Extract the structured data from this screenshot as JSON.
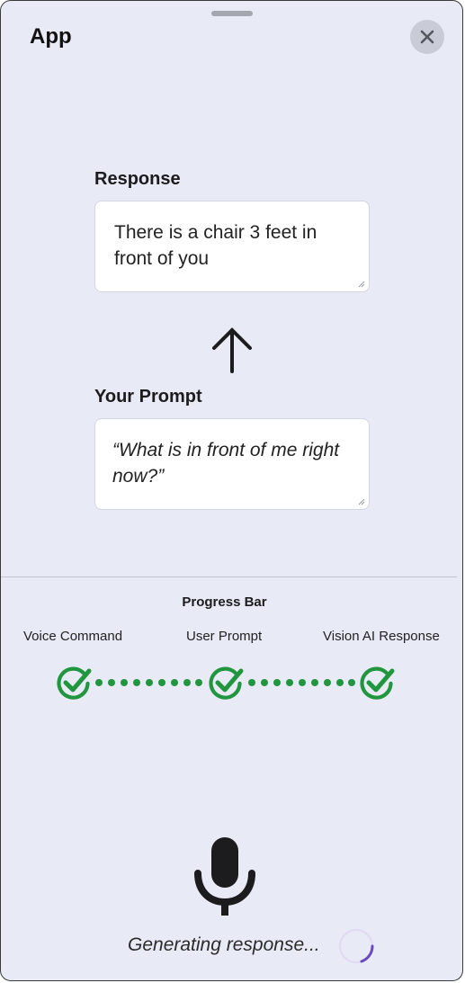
{
  "header": {
    "title": "App",
    "close_icon": "close-icon"
  },
  "response": {
    "label": "Response",
    "text": "There is a chair 3 feet in front of you"
  },
  "arrow_icon": "arrow-up-icon",
  "prompt": {
    "label": "Your Prompt",
    "text": "“What is in front of me right now?”"
  },
  "progress": {
    "title": "Progress Bar",
    "steps": [
      {
        "label": "Voice Command",
        "status": "complete",
        "icon": "check-circle-icon"
      },
      {
        "label": "User Prompt",
        "status": "complete",
        "icon": "check-circle-icon"
      },
      {
        "label": "Vision AI Response",
        "status": "complete",
        "icon": "check-circle-icon"
      }
    ],
    "completed_steps": 3,
    "total_steps": 3
  },
  "mic_icon": "microphone-icon",
  "status": {
    "text": "Generating response...",
    "spinner_icon": "loading-spinner-icon"
  },
  "colors": {
    "background": "#e8eaf5",
    "success": "#22963e",
    "spinner_accent": "#6a4bbf"
  }
}
